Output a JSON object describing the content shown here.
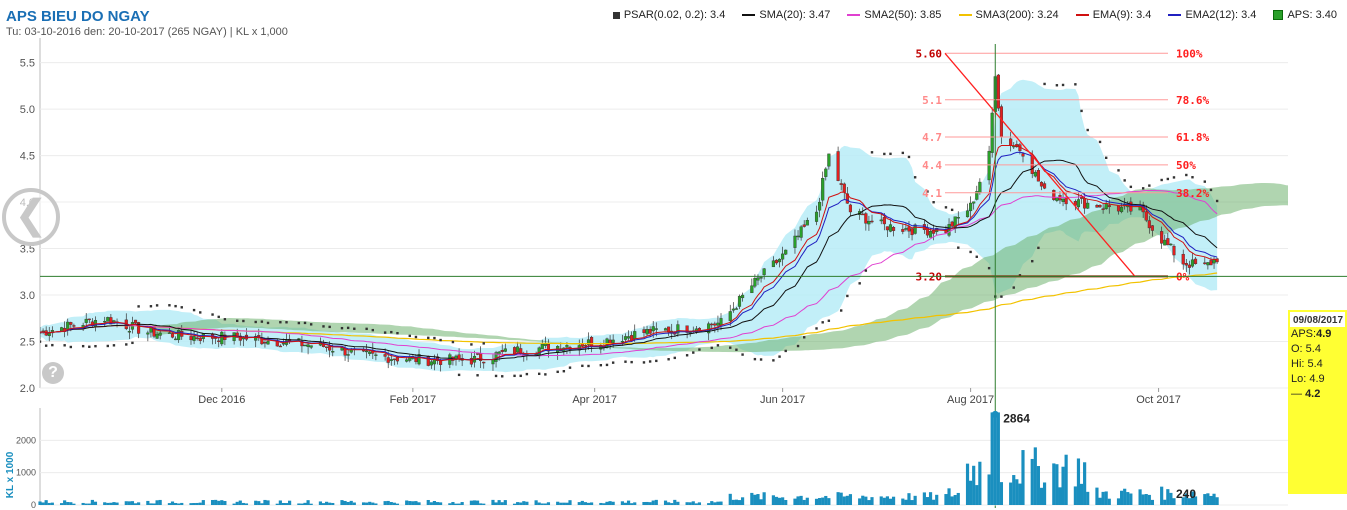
{
  "header": {
    "title": "APS BIEU DO NGAY",
    "subtitle": "Tu: 03-10-2016 den: 20-10-2017 (265 NGAY) | KL x 1,000"
  },
  "legend": [
    {
      "label": "PSAR(0.02, 0.2): 3.4",
      "color": "#333333",
      "kind": "square"
    },
    {
      "label": "SMA(20): 3.47",
      "color": "#111111",
      "kind": "line"
    },
    {
      "label": "SMA2(50): 3.85",
      "color": "#e040d0",
      "kind": "line"
    },
    {
      "label": "SMA3(200): 3.24",
      "color": "#f2c200",
      "kind": "line"
    },
    {
      "label": "EMA(9): 3.4",
      "color": "#d01010",
      "kind": "line"
    },
    {
      "label": "EMA2(12): 3.4",
      "color": "#2020c0",
      "kind": "line"
    },
    {
      "label": "APS: 3.40",
      "color": "#2aa02a",
      "kind": "box"
    }
  ],
  "tooltip": {
    "date": "09/08/2017",
    "aps_label": "APS:",
    "aps": "4.9",
    "open": "O: 5.4",
    "high": "Hi: 5.4",
    "low": "Lo: 4.9",
    "last": "4.2"
  },
  "colors": {
    "up": "#2aa02a",
    "down": "#e02020",
    "cloud_bull": "#6fb36f",
    "cloud_bear": "#ff8cff",
    "bollinger": "#b7ecf7",
    "fib": "#ff2020",
    "volume": "#1a8fbf",
    "crosshair": "#2e7d2e"
  },
  "chart_data": [
    {
      "type": "line",
      "title": "APS BIEU DO NGAY",
      "ylim": [
        2.0,
        5.7
      ],
      "yticks": [
        "2.0",
        "2.5",
        "3.0",
        "3.5",
        "4.0",
        "4.5",
        "5.0",
        "5.5"
      ],
      "xticks": [
        "Dec 2016",
        "Feb 2017",
        "Apr 2017",
        "Jun 2017",
        "Aug 2017",
        "Oct 2017"
      ],
      "price_marker": "3.20",
      "crosshair_date": "09/08/2017",
      "price_close": [
        {
          "date": "2016-10-03",
          "close": 2.6
        },
        {
          "date": "2016-10-24",
          "close": 2.75
        },
        {
          "date": "2016-11-07",
          "close": 2.6
        },
        {
          "date": "2016-11-21",
          "close": 2.55
        },
        {
          "date": "2016-12-05",
          "close": 2.55
        },
        {
          "date": "2016-12-19",
          "close": 2.5
        },
        {
          "date": "2017-01-03",
          "close": 2.45
        },
        {
          "date": "2017-01-16",
          "close": 2.35
        },
        {
          "date": "2017-02-06",
          "close": 2.3
        },
        {
          "date": "2017-02-20",
          "close": 2.3
        },
        {
          "date": "2017-03-06",
          "close": 2.4
        },
        {
          "date": "2017-03-20",
          "close": 2.45
        },
        {
          "date": "2017-04-03",
          "close": 2.5
        },
        {
          "date": "2017-04-17",
          "close": 2.6
        },
        {
          "date": "2017-05-02",
          "close": 2.65
        },
        {
          "date": "2017-05-12",
          "close": 2.7
        },
        {
          "date": "2017-05-22",
          "close": 3.1
        },
        {
          "date": "2017-06-02",
          "close": 3.45
        },
        {
          "date": "2017-06-12",
          "close": 3.9
        },
        {
          "date": "2017-06-16",
          "close": 4.5
        },
        {
          "date": "2017-06-23",
          "close": 3.9
        },
        {
          "date": "2017-07-03",
          "close": 3.75
        },
        {
          "date": "2017-07-14",
          "close": 3.7
        },
        {
          "date": "2017-07-24",
          "close": 3.7
        },
        {
          "date": "2017-08-01",
          "close": 3.95
        },
        {
          "date": "2017-08-07",
          "close": 4.5
        },
        {
          "date": "2017-08-09",
          "close": 5.4
        },
        {
          "date": "2017-08-11",
          "close": 4.7
        },
        {
          "date": "2017-08-18",
          "close": 4.55
        },
        {
          "date": "2017-08-25",
          "close": 4.1
        },
        {
          "date": "2017-09-05",
          "close": 4.0
        },
        {
          "date": "2017-09-15",
          "close": 3.95
        },
        {
          "date": "2017-09-25",
          "close": 3.9
        },
        {
          "date": "2017-10-02",
          "close": 3.6
        },
        {
          "date": "2017-10-09",
          "close": 3.35
        },
        {
          "date": "2017-10-16",
          "close": 3.3
        },
        {
          "date": "2017-10-20",
          "close": 3.4
        }
      ],
      "fibonacci": [
        {
          "level": "100%",
          "price": "5.60",
          "value": 5.6
        },
        {
          "level": "78.6%",
          "price": "5.1",
          "value": 5.1
        },
        {
          "level": "61.8%",
          "price": "4.7",
          "value": 4.7
        },
        {
          "level": "50%",
          "price": "4.4",
          "value": 4.4
        },
        {
          "level": "38.2%",
          "price": "4.1",
          "value": 4.1
        },
        {
          "level": "0%",
          "price": "3.20",
          "value": 3.2
        }
      ]
    },
    {
      "type": "bar",
      "ylabel": "KL x 1000",
      "ylim": [
        0,
        3000
      ],
      "yticks": [
        "0",
        "1000",
        "2000"
      ],
      "peak_label": "2864",
      "peak_value": 2864,
      "last_label": "240",
      "last_value": 240
    }
  ]
}
